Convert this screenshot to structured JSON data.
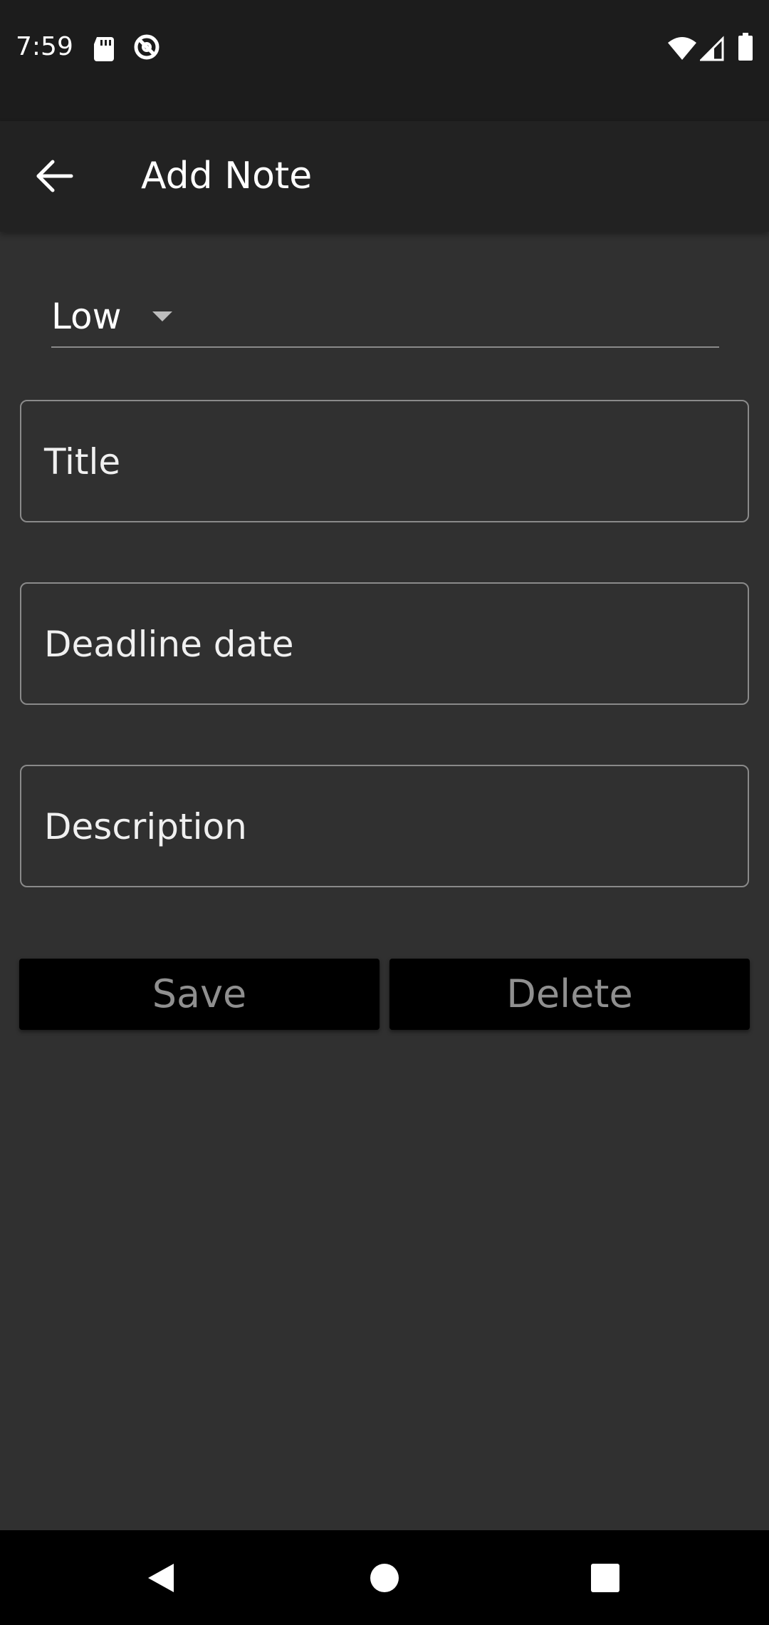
{
  "status_bar": {
    "time": "7:59",
    "icons": [
      "sd-card-icon",
      "sync-disabled-icon",
      "wifi-icon",
      "cell-signal-icon",
      "battery-icon"
    ]
  },
  "app_bar": {
    "title": "Add Note",
    "back_icon": "arrow-back-icon"
  },
  "form": {
    "priority": {
      "value": "Low",
      "icon": "dropdown-triangle-icon"
    },
    "title_field": {
      "label": "Title",
      "value": ""
    },
    "deadline_field": {
      "label": "Deadline date",
      "value": ""
    },
    "description_field": {
      "label": "Description",
      "value": ""
    }
  },
  "actions": {
    "save_label": "Save",
    "delete_label": "Delete"
  },
  "nav_bar": {
    "icons": [
      "nav-back-icon",
      "nav-home-icon",
      "nav-recents-icon"
    ]
  },
  "colors": {
    "background": "#303030",
    "status_bar": "#1c1c1c",
    "app_bar": "#222222",
    "button_bg": "#000000",
    "button_text": "#8f8f8f",
    "field_border": "#8a8a8a",
    "text": "#ffffff"
  }
}
